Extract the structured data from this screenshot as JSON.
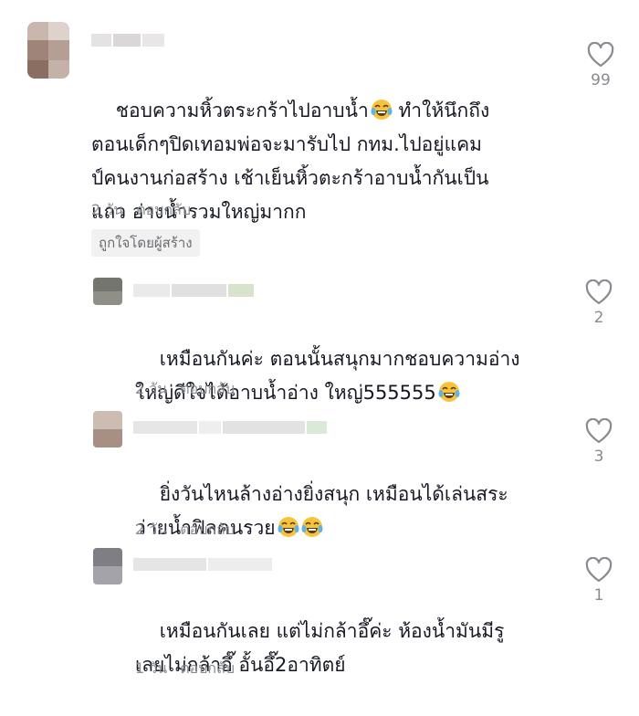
{
  "comments": [
    {
      "text": "ชอบความหิ้วตระกร้าไปอาบน้ำ",
      "text_cont": " ทำให้นึกถึง\nตอนเด็กๆปิดเทอมพ่อจะมารับไป กทม.ไปอยู่แคม\nป์คนงานก่อสร้าง เช้าเย็นหิ้วตะกร้าอาบน้ำกันเป็น\nแถว อ่างน้ำรวมใหญ่มากก",
      "time": "2 วัน",
      "reply": "ตอบกลับ",
      "badge": "ถูกใจโดยผู้สร้าง",
      "likes": "99"
    },
    {
      "text": "เหมือนกันค่ะ ตอนนั้นสนุกมากชอบความอ่าง\nใหญ่ดีใจได้อาบน้ำอ่าง ใหญ่555555",
      "time": "2 วัน",
      "reply": "ตอบกลับ",
      "likes": "2"
    },
    {
      "text": "ยิ่งวันไหนล้างอ่างยิ่งสนุก เหมือนได้เล่นสระ\nว่ายน้ำฟิลคนรวย",
      "time": "2 วัน",
      "reply": "ตอบกลับ",
      "likes": "3"
    },
    {
      "text": "เหมือนกันเลย แต่ไม่กล้าอึ๊ค่ะ ห้องน้ำมันมีรู\nเลยไม่กล้าอึ๊ อั้นอึ๊2อาทิตย์",
      "time": "1 วัน",
      "reply": "ตอบกลับ",
      "likes": "1"
    }
  ],
  "icons": {
    "like": "heart-outline-icon",
    "emoji": "tears-of-joy-emoji-icon"
  },
  "colors": {
    "text": "#161823",
    "meta": "#8a8b91",
    "badge_bg": "#f1f1f2"
  }
}
